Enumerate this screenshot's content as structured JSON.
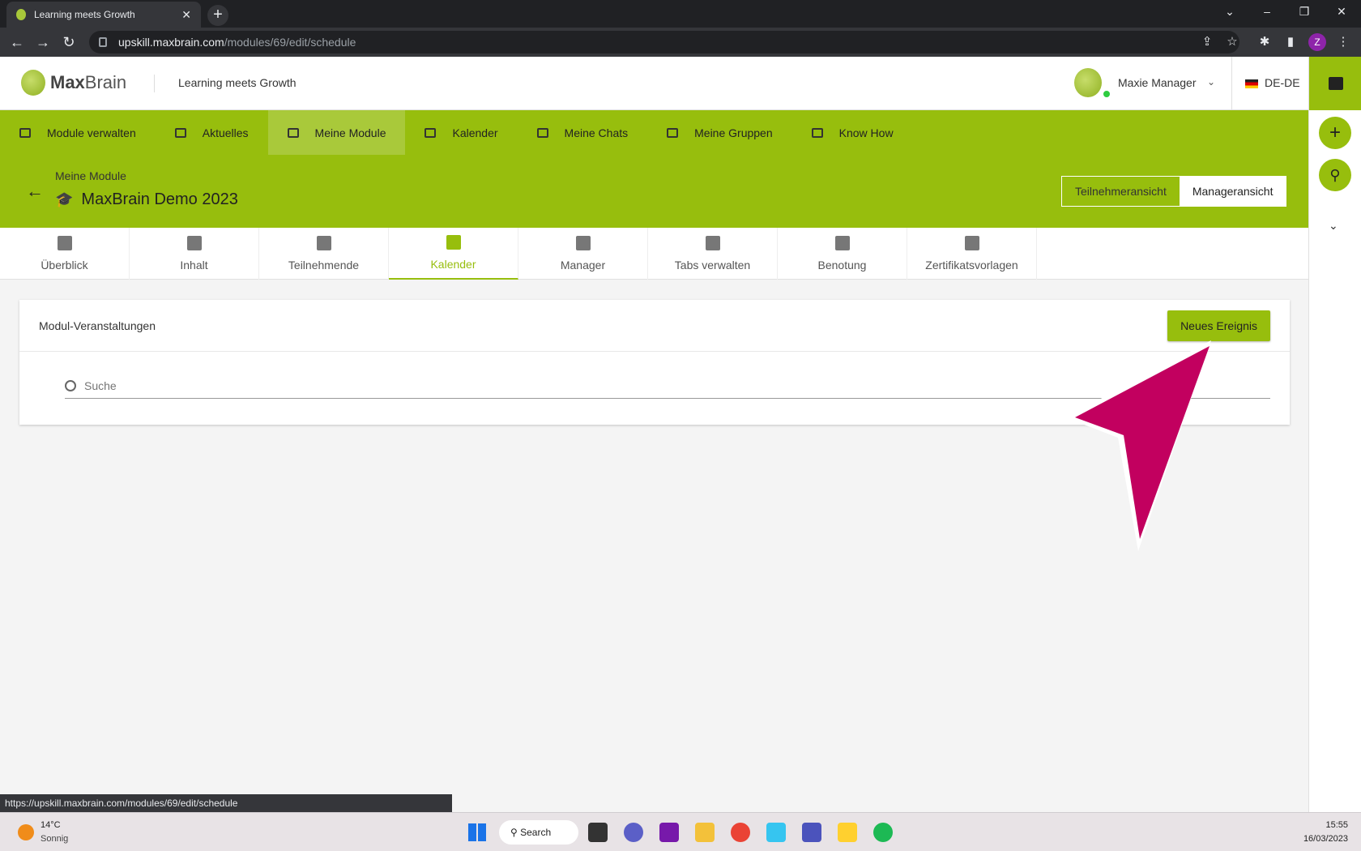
{
  "browser": {
    "tab_title": "Learning meets Growth",
    "tab_close": "✕",
    "new_tab": "+",
    "url_host": "upskill.maxbrain.com",
    "url_path": "/modules/69/edit/schedule",
    "profile_initial": "Z",
    "status_url": "https://upskill.maxbrain.com/modules/69/edit/schedule"
  },
  "header": {
    "logo_bold": "Max",
    "logo_rest": "Brain",
    "tagline": "Learning meets Growth",
    "user_name": "Maxie Manager",
    "language": "DE-DE"
  },
  "mainnav": {
    "items": [
      {
        "label": "Module verwalten"
      },
      {
        "label": "Aktuelles"
      },
      {
        "label": "Meine Module"
      },
      {
        "label": "Kalender"
      },
      {
        "label": "Meine Chats"
      },
      {
        "label": "Meine Gruppen"
      },
      {
        "label": "Know How"
      }
    ]
  },
  "module": {
    "breadcrumb": "Meine Module",
    "title": "MaxBrain Demo 2023",
    "view_participant": "Teilnehmeransicht",
    "view_manager": "Manageransicht"
  },
  "subtabs": {
    "items": [
      {
        "label": "Überblick"
      },
      {
        "label": "Inhalt"
      },
      {
        "label": "Teilnehmende"
      },
      {
        "label": "Kalender"
      },
      {
        "label": "Manager"
      },
      {
        "label": "Tabs verwalten"
      },
      {
        "label": "Benotung"
      },
      {
        "label": "Zertifikatsvorlagen"
      }
    ]
  },
  "card": {
    "title": "Modul-Veranstaltungen",
    "new_event_label": "Neues Ereignis",
    "search_placeholder": "Suche"
  },
  "taskbar": {
    "temperature": "14°C",
    "weather": "Sonnig",
    "search_label": "Search",
    "time": "15:55",
    "date": "16/03/2023"
  },
  "colors": {
    "brand_green": "#97be0d",
    "pointer_magenta": "#c2005f"
  }
}
